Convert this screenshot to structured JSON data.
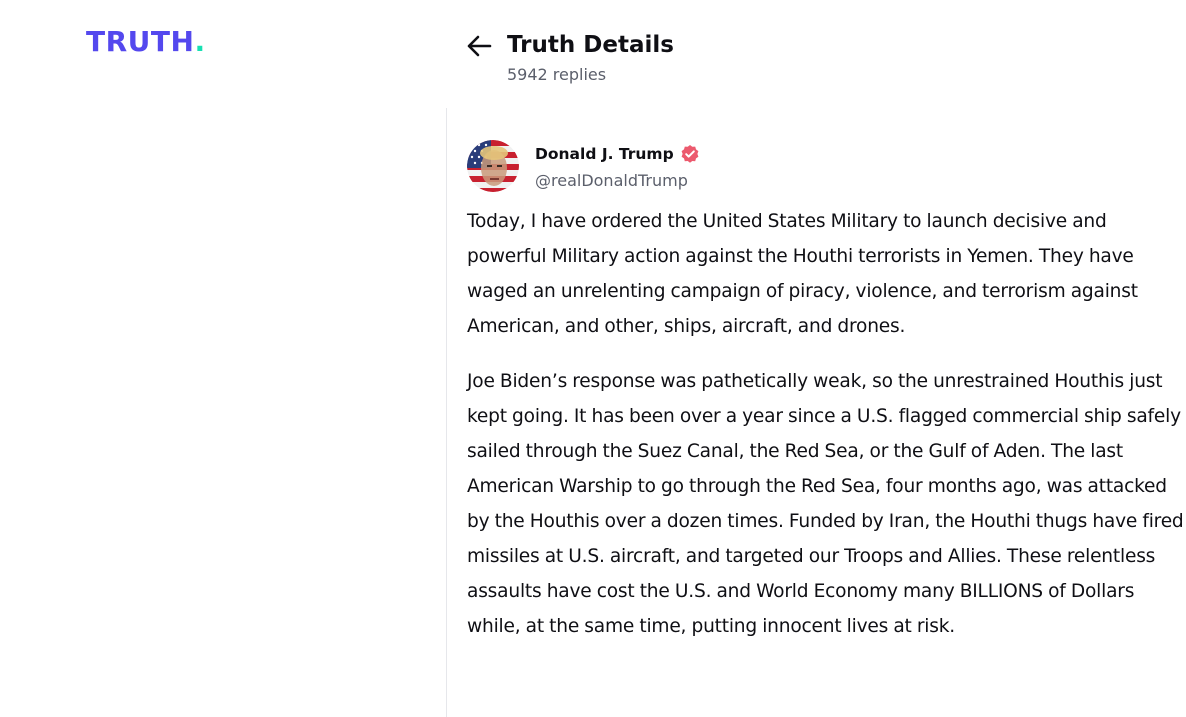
{
  "brand": {
    "logo_text": "TRUTH",
    "logo_dot": ".",
    "logo_color": "#5448ee",
    "logo_dot_color": "#17e0b2"
  },
  "header": {
    "back_icon": "arrow-left-icon",
    "title": "Truth Details",
    "reply_count": "5942 replies"
  },
  "post": {
    "author_name": "Donald J. Trump",
    "verified_icon": "verified-badge-icon",
    "verified_color": "#ec5a6e",
    "author_handle": "@realDonaldTrump",
    "paragraphs": [
      "Today, I have ordered the United States Military to launch decisive and powerful Military action against the Houthi terrorists in Yemen. They have waged an unrelenting campaign of piracy, violence, and terrorism against American, and other, ships, aircraft, and drones.",
      "Joe Biden’s response was pathetically weak, so the unrestrained Houthis just kept going. It has been over a year since a U.S. flagged commercial ship safely sailed through the Suez Canal, the Red Sea, or the Gulf of Aden. The last American Warship to go through the Red Sea, four months ago, was attacked by the Houthis over a dozen times. Funded by Iran, the Houthi thugs have fired missiles at U.S. aircraft, and targeted our Troops and Allies. These relentless assaults have cost the U.S. and World Economy many BILLIONS of Dollars while, at the same time, putting innocent lives at risk."
    ]
  }
}
